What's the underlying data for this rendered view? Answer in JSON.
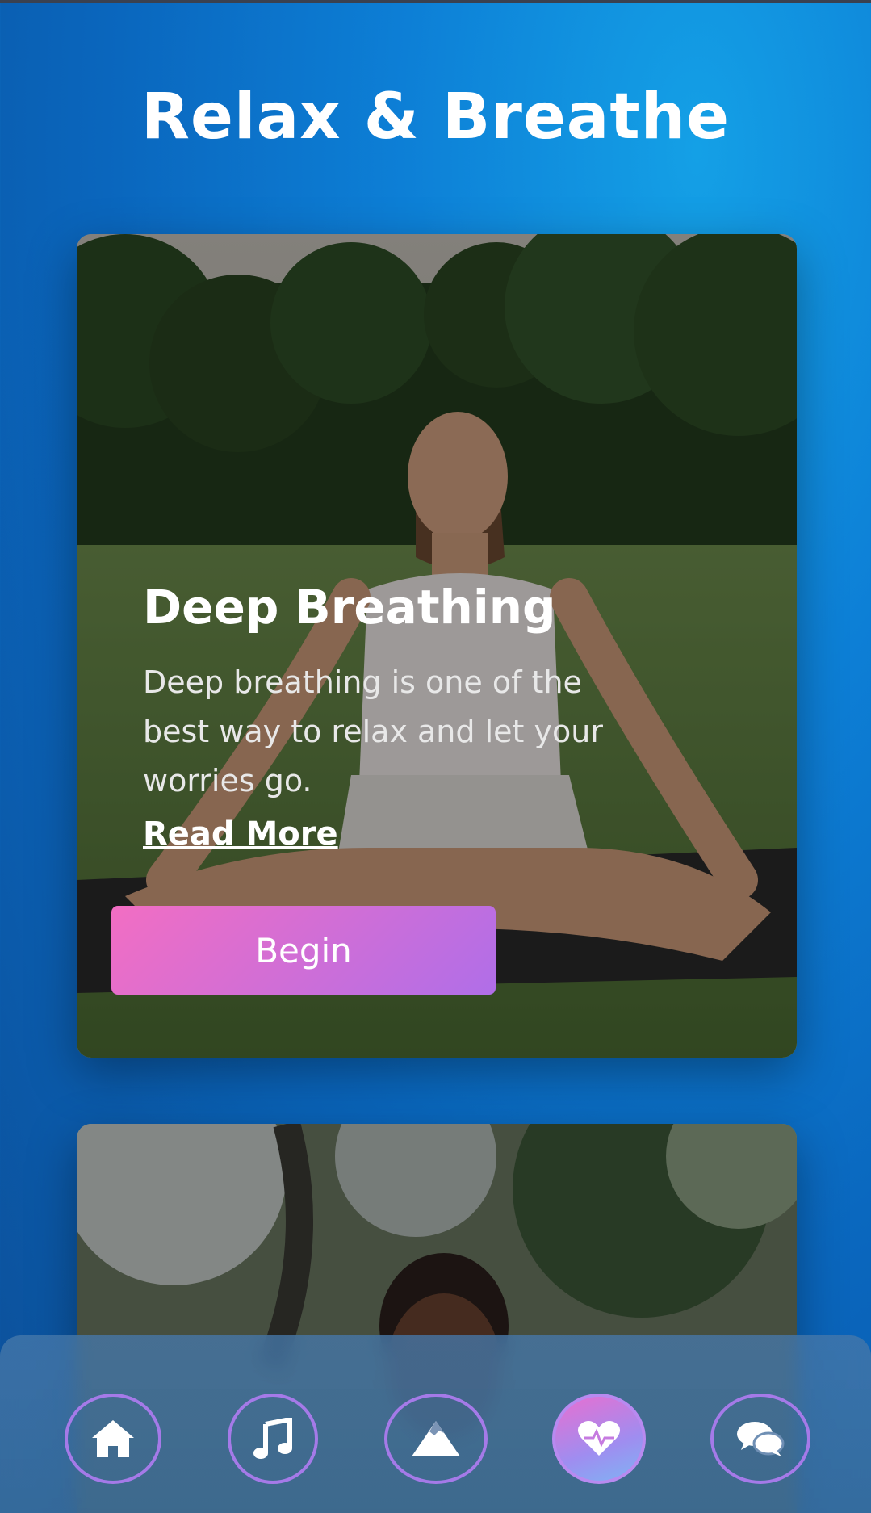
{
  "page": {
    "title": "Relax & Breathe"
  },
  "cards": [
    {
      "title": "Deep Breathing",
      "description": "Deep breathing is one of the best way to relax and let your worries go.",
      "read_more": "Read More",
      "button": "Begin"
    }
  ],
  "nav": {
    "items": [
      {
        "icon": "home-icon"
      },
      {
        "icon": "music-icon"
      },
      {
        "icon": "mountain-icon"
      },
      {
        "icon": "heartbeat-icon",
        "active": true
      },
      {
        "icon": "chat-icon"
      }
    ]
  },
  "colors": {
    "background": "#0d7fd6",
    "button_gradient_start": "#f26ec3",
    "button_gradient_end": "#b06ee8",
    "nav_ring": "#a57ae8"
  }
}
